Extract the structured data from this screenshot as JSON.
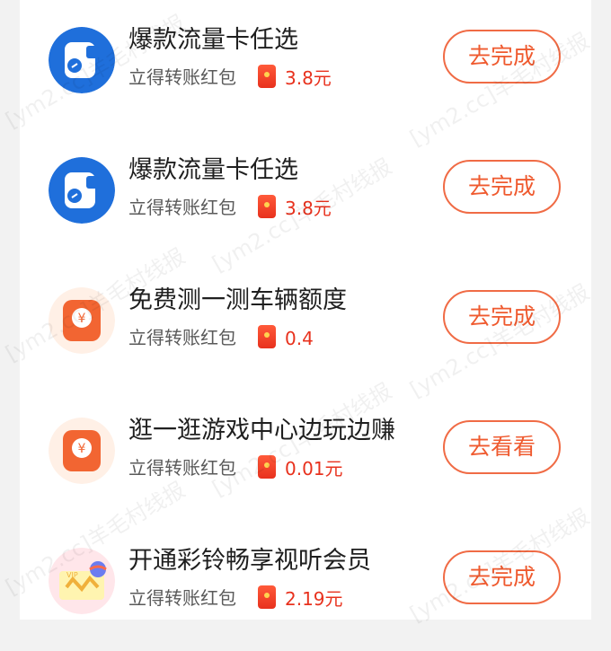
{
  "tasks": [
    {
      "title": "爆款流量卡任选",
      "subtitle": "立得转账红包",
      "reward": "3.8元",
      "button": "去完成",
      "icon": "sim-card-icon"
    },
    {
      "title": "爆款流量卡任选",
      "subtitle": "立得转账红包",
      "reward": "3.8元",
      "button": "去完成",
      "icon": "sim-card-icon"
    },
    {
      "title": "免费测一测车辆额度",
      "subtitle": "立得转账红包",
      "reward": "0.4",
      "button": "去完成",
      "icon": "yuan-card-icon"
    },
    {
      "title": "逛一逛游戏中心边玩边赚",
      "subtitle": "立得转账红包",
      "reward": "0.01元",
      "button": "去看看",
      "icon": "yuan-card-icon"
    },
    {
      "title": "开通彩铃畅享视听会员",
      "subtitle": "立得转账红包",
      "reward": "2.19元",
      "button": "去完成",
      "icon": "vip-card-icon"
    }
  ],
  "watermark": "[ym2.cc]羊毛村线报",
  "colors": {
    "accent": "#ef5a2f",
    "reward": "#e8311d",
    "sim_icon": "#1f6fdb",
    "yuan_icon": "#f26532"
  }
}
